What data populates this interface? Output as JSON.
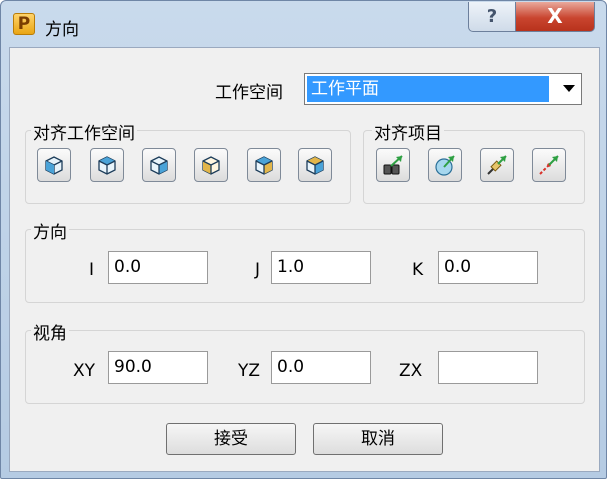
{
  "window": {
    "title": "方向",
    "app_icon_letter": "P",
    "help_glyph": "?",
    "close_glyph": "X"
  },
  "workspace": {
    "label": "工作空间",
    "selected": "工作平面"
  },
  "align_workspace": {
    "title": "对齐工作空间",
    "buttons": [
      {
        "icon": "align-cube-front-icon"
      },
      {
        "icon": "align-cube-top-icon"
      },
      {
        "icon": "align-cube-side-icon"
      },
      {
        "icon": "align-cube-front-reverse-icon"
      },
      {
        "icon": "align-cube-top-reverse-icon"
      },
      {
        "icon": "align-cube-side-reverse-icon"
      }
    ]
  },
  "align_item": {
    "title": "对齐项目",
    "buttons": [
      {
        "icon": "align-binoculars-icon"
      },
      {
        "icon": "align-sphere-icon"
      },
      {
        "icon": "align-tool-icon"
      },
      {
        "icon": "align-line-icon"
      }
    ]
  },
  "direction": {
    "title": "方向",
    "i_label": "I",
    "i_value": "0.0",
    "j_label": "J",
    "j_value": "1.0",
    "k_label": "K",
    "k_value": "0.0"
  },
  "view_angle": {
    "title": "视角",
    "xy_label": "XY",
    "xy_value": "90.0",
    "yz_label": "YZ",
    "yz_value": "0.0",
    "zx_label": "ZX",
    "zx_value": ""
  },
  "buttons": {
    "accept": "接受",
    "cancel": "取消"
  },
  "colors": {
    "selection": "#3399ff",
    "cube_blue": "#4aa3d8",
    "arrow_green": "#2ea043",
    "close_red": "#c9452f"
  }
}
